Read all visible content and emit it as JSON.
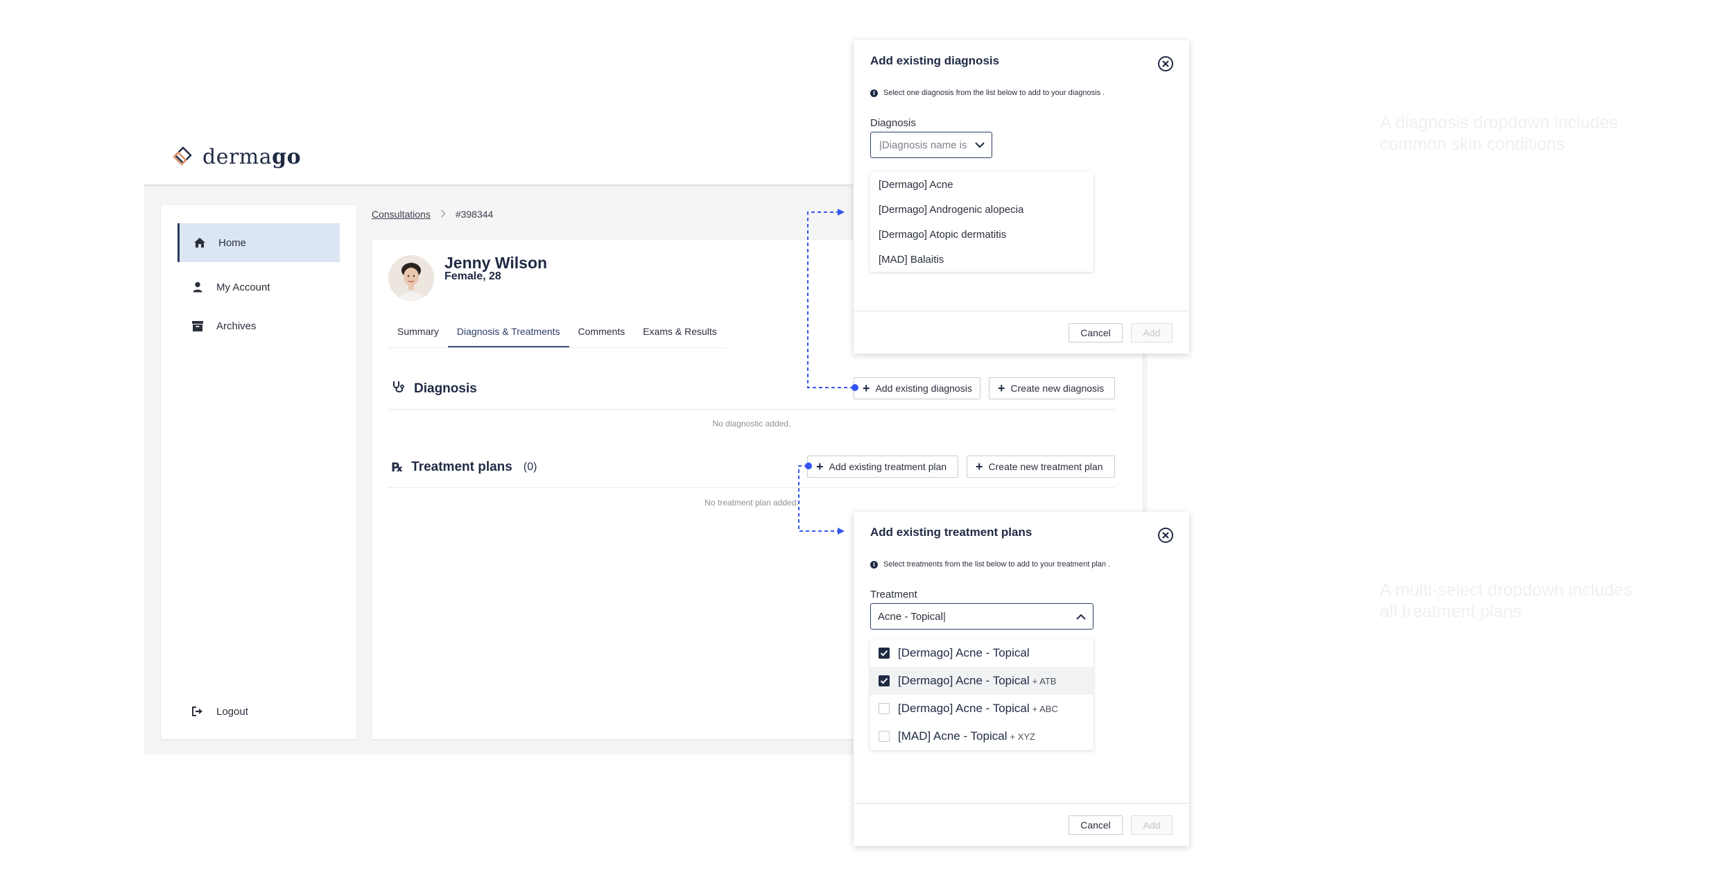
{
  "brand": {
    "name_regular": "derma",
    "name_bold": "go"
  },
  "sidebar": {
    "items": [
      {
        "label": "Home",
        "icon": "home-icon",
        "active": true
      },
      {
        "label": "My Account",
        "icon": "user-icon",
        "active": false
      },
      {
        "label": "Archives",
        "icon": "archive-icon",
        "active": false
      }
    ],
    "logout_label": "Logout"
  },
  "breadcrumb": {
    "parent": "Consultations",
    "current": "#398344"
  },
  "patient": {
    "name": "Jenny Wilson",
    "info": "Female, 28"
  },
  "tabs": [
    {
      "label": "Summary",
      "active": false
    },
    {
      "label": "Diagnosis & Treatments",
      "active": true
    },
    {
      "label": "Comments",
      "active": false
    },
    {
      "label": "Exams & Results",
      "active": false
    }
  ],
  "diagnosis_section": {
    "title": "Diagnosis",
    "add_existing_label": "Add existing diagnosis",
    "create_new_label": "Create new diagnosis",
    "empty_text": "No diagnostic added."
  },
  "treatment_section": {
    "title": "Treatment plans",
    "count": "(0)",
    "add_existing_label": "Add existing treatment plan",
    "create_new_label": "Create new treatment plan",
    "empty_text": "No treatment plan added."
  },
  "diagnosis_modal": {
    "title": "Add existing diagnosis",
    "info": "Select one diagnosis from the list below to add to your diagnosis .",
    "field_label": "Diagnosis",
    "placeholder": "|Diagnosis name is",
    "options": [
      "[Dermago] Acne",
      "[Dermago] Androgenic alopecia",
      "[Dermago] Atopic dermatitis",
      "[MAD] Balaitis"
    ],
    "cancel_label": "Cancel",
    "add_label": "Add"
  },
  "treatment_modal": {
    "title": "Add existing treatment plans",
    "info": "Select treatments from the list below to add to your treatment plan .",
    "field_label": "Treatment",
    "value": "Acne - Topical|",
    "options": [
      {
        "label": "[Dermago] Acne - Topical",
        "suffix": "",
        "checked": true
      },
      {
        "label": "[Dermago] Acne - Topical",
        "suffix": "+ ATB",
        "checked": true
      },
      {
        "label": "[Dermago] Acne - Topical",
        "suffix": "+ ABC",
        "checked": false
      },
      {
        "label": "[MAD] Acne - Topical",
        "suffix": "+ XYZ",
        "checked": false
      }
    ],
    "cancel_label": "Cancel",
    "add_label": "Add"
  },
  "annotations": {
    "diagnosis_note": [
      "A diagnosis dropdown includes",
      "common skin conditions"
    ],
    "treatment_note": [
      "A multi-select dropdown includes",
      "all treatment plans"
    ]
  },
  "colors": {
    "primary": "#1f2a44",
    "accent": "#2b3e66",
    "connector": "#3355ee",
    "active_nav": "#dbe6f2"
  }
}
